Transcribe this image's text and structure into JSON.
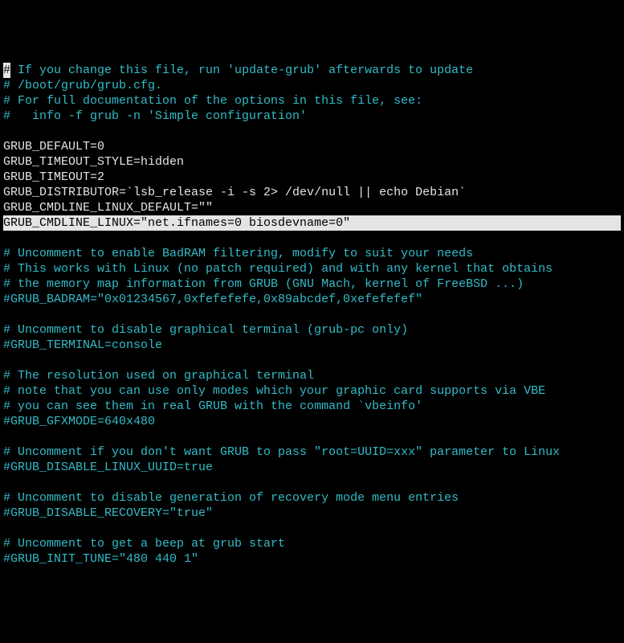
{
  "lines": {
    "l1_cursor": "#",
    "l1_rest": " If you change this file, run 'update-grub' afterwards to update",
    "l2": "# /boot/grub/grub.cfg.",
    "l3": "# For full documentation of the options in this file, see:",
    "l4": "#   info -f grub -n 'Simple configuration'",
    "l5": " ",
    "l6": "GRUB_DEFAULT=0",
    "l7": "GRUB_TIMEOUT_STYLE=hidden",
    "l8": "GRUB_TIMEOUT=2",
    "l9": "GRUB_DISTRIBUTOR=`lsb_release -i -s 2> /dev/null || echo Debian`",
    "l10": "GRUB_CMDLINE_LINUX_DEFAULT=\"\"",
    "l11": "GRUB_CMDLINE_LINUX=\"net.ifnames=0 biosdevname=0\"",
    "l12": " ",
    "l13": "# Uncomment to enable BadRAM filtering, modify to suit your needs",
    "l14": "# This works with Linux (no patch required) and with any kernel that obtains",
    "l15": "# the memory map information from GRUB (GNU Mach, kernel of FreeBSD ...)",
    "l16": "#GRUB_BADRAM=\"0x01234567,0xfefefefe,0x89abcdef,0xefefefef\"",
    "l17": " ",
    "l18": "# Uncomment to disable graphical terminal (grub-pc only)",
    "l19": "#GRUB_TERMINAL=console",
    "l20": " ",
    "l21": "# The resolution used on graphical terminal",
    "l22": "# note that you can use only modes which your graphic card supports via VBE",
    "l23": "# you can see them in real GRUB with the command `vbeinfo'",
    "l24": "#GRUB_GFXMODE=640x480",
    "l25": " ",
    "l26": "# Uncomment if you don't want GRUB to pass \"root=UUID=xxx\" parameter to Linux",
    "l27": "#GRUB_DISABLE_LINUX_UUID=true",
    "l28": " ",
    "l29": "# Uncomment to disable generation of recovery mode menu entries",
    "l30": "#GRUB_DISABLE_RECOVERY=\"true\"",
    "l31": " ",
    "l32": "# Uncomment to get a beep at grub start",
    "l33": "#GRUB_INIT_TUNE=\"480 440 1\""
  }
}
